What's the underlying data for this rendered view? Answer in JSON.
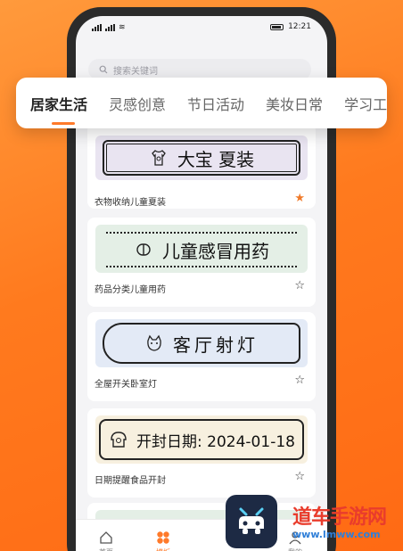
{
  "status": {
    "time": "12:21"
  },
  "search": {
    "placeholder": "搜索关键词"
  },
  "tabs": [
    "居家生活",
    "灵感创意",
    "节日活动",
    "美妆日常",
    "学习工"
  ],
  "templates": [
    {
      "tape_text": "大宝 夏装",
      "label": "衣物收纳儿童夏装",
      "favorited": true,
      "bg": "#e9e4f1"
    },
    {
      "tape_text": "儿童感冒用药",
      "label": "药品分类儿童用药",
      "favorited": false,
      "bg": "#e4efe6"
    },
    {
      "tape_text": "客厅射灯",
      "label": "全屋开关卧室灯",
      "favorited": false,
      "bg": "#e3eaf6"
    },
    {
      "tape_text": "开封日期: 2024-01-18",
      "label": "日期提醒食品开封",
      "favorited": false,
      "bg": "#f7f0df"
    }
  ],
  "nav": [
    {
      "label": "首页",
      "icon": "home-icon"
    },
    {
      "label": "模板",
      "icon": "template-grid-icon"
    },
    {
      "label": "我的",
      "icon": "profile-icon"
    }
  ],
  "watermark": {
    "text": "道车手游网",
    "url": "www.lmww.com"
  },
  "colors": {
    "accent": "#ff7a2a",
    "star_active": "#f07a2a"
  }
}
